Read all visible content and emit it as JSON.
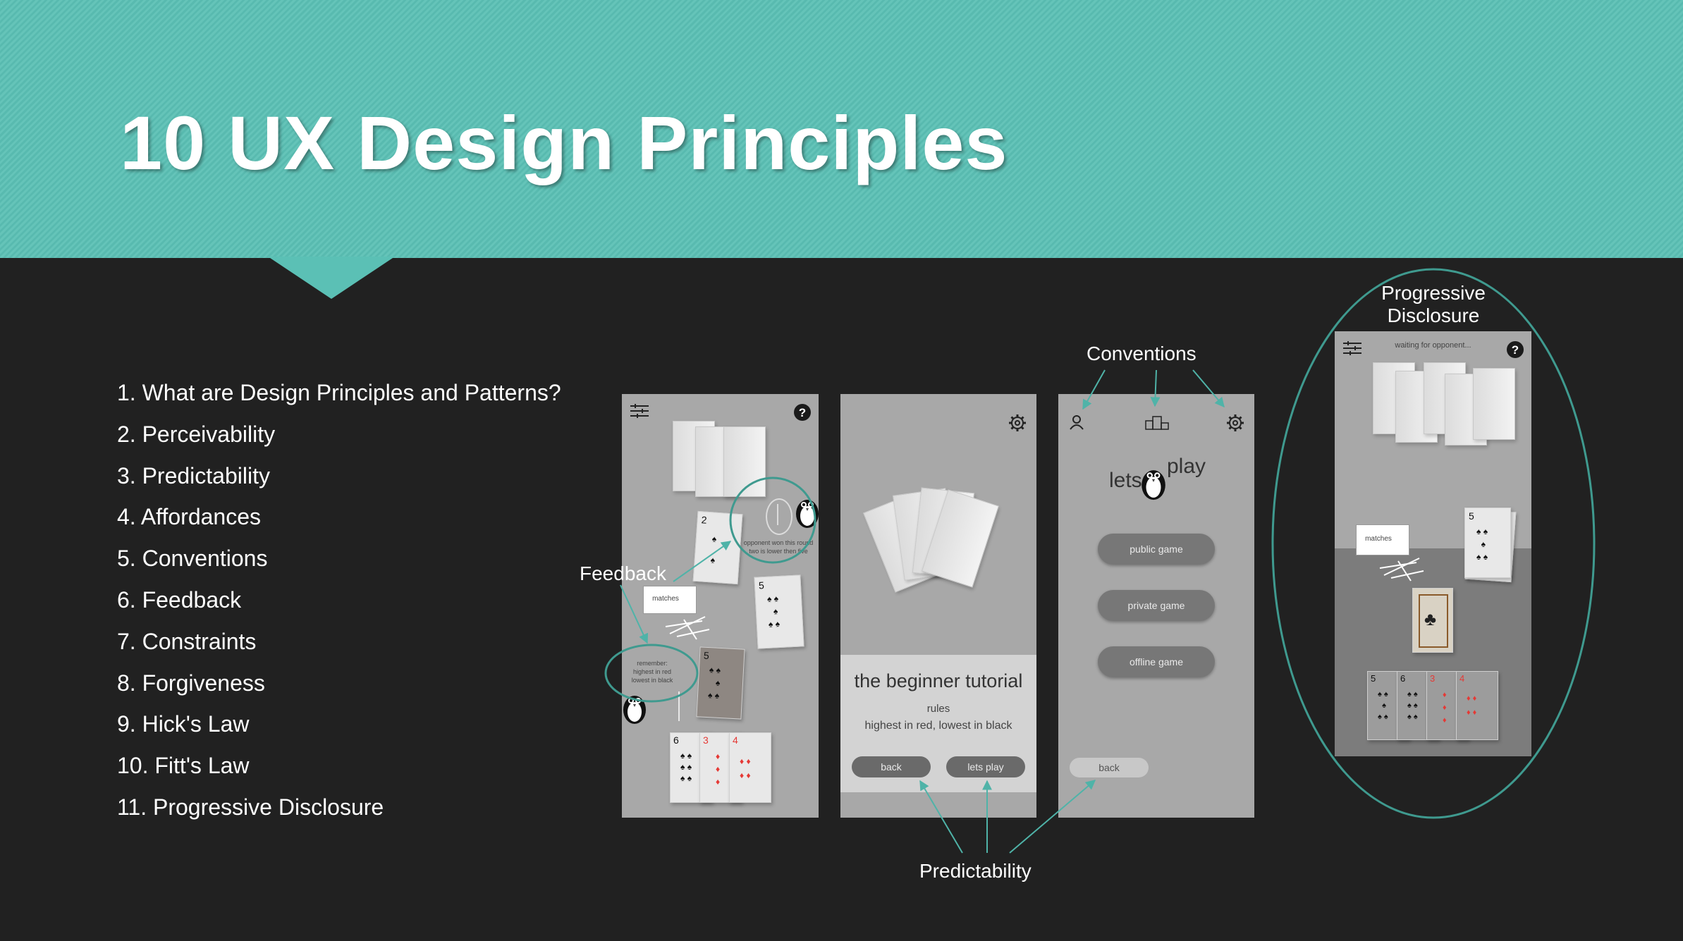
{
  "slide": {
    "title": "10 UX Design Principles",
    "agenda": [
      "1. What are Design Principles and Patterns?",
      "2. Perceivability",
      "3. Predictability",
      "4. Affordances",
      "5. Conventions",
      "6. Feedback",
      "7. Constraints",
      "8. Forgiveness",
      "9. Hick's Law",
      "10. Fitt's Law",
      "11. Progressive Disclosure"
    ]
  },
  "annotations": {
    "feedback": "Feedback",
    "conventions": "Conventions",
    "predictability": "Predictability",
    "progressive_disclosure_line1": "Progressive",
    "progressive_disclosure_line2": "Disclosure"
  },
  "screen1": {
    "matches_label": "matches",
    "opponent_msg_line1": "opponent won this round",
    "opponent_msg_line2": "two is lower then five",
    "remember_line1": "remember:",
    "remember_line2": "highest in red",
    "remember_line3": "lowest in black",
    "hand_cards": [
      "6",
      "3",
      "4"
    ],
    "table_cards": [
      "2",
      "5",
      "5"
    ]
  },
  "screen2": {
    "tutorial_title": "the beginner tutorial",
    "rules_heading": "rules",
    "rules_text": "highest in red, lowest in black",
    "back_button": "back",
    "play_button": "lets play"
  },
  "screen3": {
    "logo_word1": "lets",
    "logo_word2": "play",
    "public_game": "public game",
    "private_game": "private game",
    "offline_game": "offline game",
    "back_button": "back"
  },
  "screen4": {
    "status": "waiting for opponent...",
    "matches_label": "matches",
    "hand_cards": [
      "5",
      "6",
      "3",
      "4"
    ],
    "table_card": "5"
  },
  "colors": {
    "banner": "#5bc0b5",
    "background": "#212121",
    "accent_teal": "#3f9a8f",
    "screen_gray": "#a8a8a8",
    "red_suit": "#e53935"
  },
  "icons": [
    "menu-icon",
    "help-icon",
    "gear-icon",
    "user-icon",
    "podium-icon",
    "penguin-icon"
  ]
}
